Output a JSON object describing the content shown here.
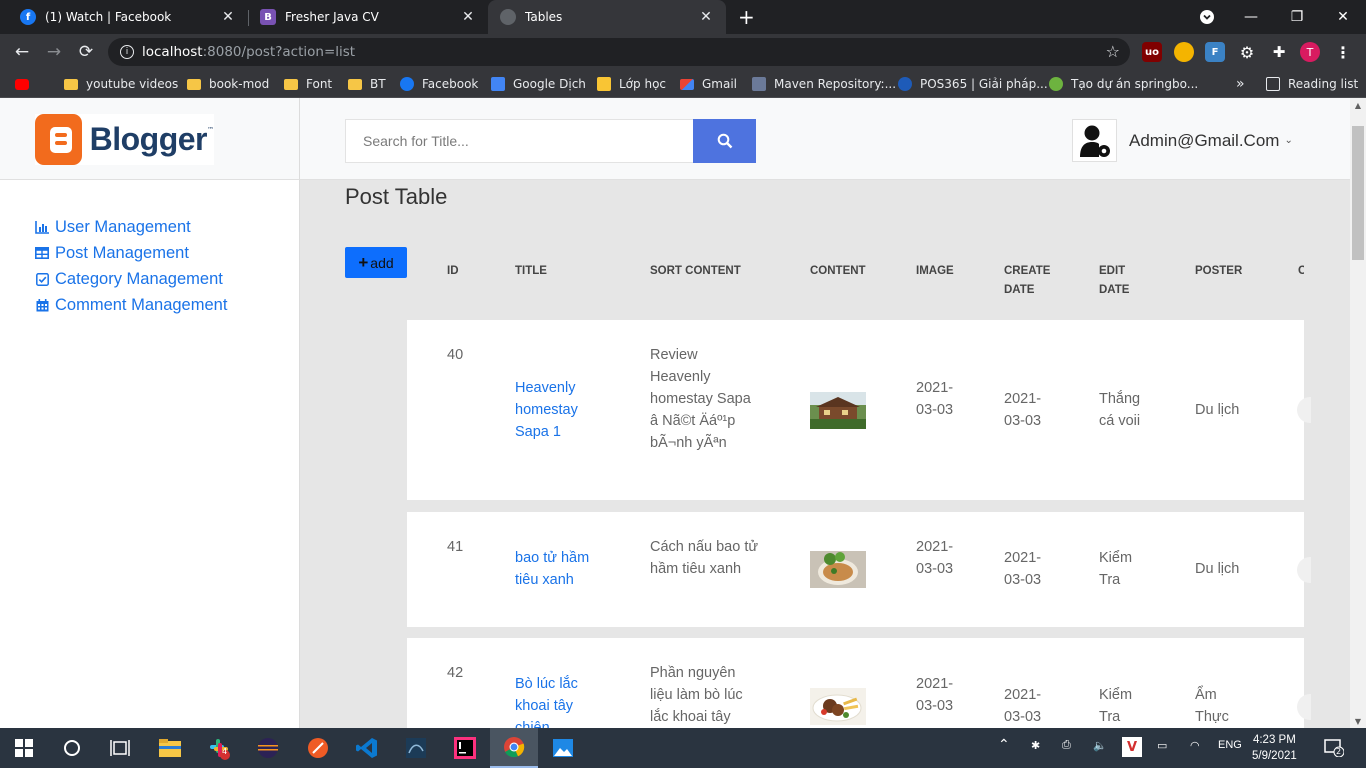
{
  "browser": {
    "tabs": [
      {
        "title": "(1) Watch | Facebook",
        "icon": "facebook-icon"
      },
      {
        "title": "Fresher Java CV",
        "icon": "bootstrap-icon"
      },
      {
        "title": "Tables",
        "icon": "globe-icon"
      }
    ],
    "url_host": "localhost",
    "url_path": ":8080/post?action=list",
    "bookmarks": [
      {
        "label": "youtube videos",
        "icon": "folder-icon"
      },
      {
        "label": "book-mod",
        "icon": "folder-icon"
      },
      {
        "label": "Font",
        "icon": "folder-icon"
      },
      {
        "label": "BT",
        "icon": "folder-icon"
      },
      {
        "label": "Facebook",
        "icon": "facebook-icon"
      },
      {
        "label": "Google Dịch",
        "icon": "google-translate-icon"
      },
      {
        "label": "Lớp học",
        "icon": "classroom-icon"
      },
      {
        "label": "Gmail",
        "icon": "gmail-icon"
      },
      {
        "label": "Maven Repository:...",
        "icon": "maven-icon"
      },
      {
        "label": "POS365 | Giải pháp...",
        "icon": "pos365-icon"
      },
      {
        "label": "Tạo dự án springbo...",
        "icon": "spring-icon"
      }
    ],
    "more_bookmarks": "»",
    "reading_list": "Reading list",
    "profile_initial": "T"
  },
  "app": {
    "logo_text": "Blogger",
    "logo_tm": "™",
    "search_placeholder": "Search for Title...",
    "account_name": "Admin@Gmail.Com",
    "page_title": "Post Table",
    "add_label": "add",
    "sidebar": [
      {
        "label": "User Management",
        "icon": "bar-chart-icon"
      },
      {
        "label": "Post Management",
        "icon": "table-icon"
      },
      {
        "label": "Category Management",
        "icon": "check-square-icon"
      },
      {
        "label": "Comment Management",
        "icon": "calendar-icon"
      }
    ],
    "columns": [
      "ID",
      "TITLE",
      "SORT CONTENT",
      "CONTENT",
      "IMAGE",
      "CREATE DATE",
      "EDIT DATE",
      "POSTER",
      "C"
    ],
    "rows": [
      {
        "id": "40",
        "title": "Heavenly homestay Sapa 1",
        "sort_content": "Review Heavenly homestay Sapa â Nã©t Äáº¹p bÃ¬nh yÃªn",
        "content_image": "homestay-thumbnail",
        "create_date": "2021-03-03",
        "edit_date": "2021-03-03",
        "poster": "Thắng cá voii",
        "category": "Du lịch"
      },
      {
        "id": "41",
        "title": "bao tử hầm tiêu xanh",
        "sort_content": "Cách nấu bao tử hầm tiêu xanh",
        "content_image": "soup-thumbnail",
        "create_date": "2021-03-03",
        "edit_date": "2021-03-03",
        "poster": "Kiểm Tra",
        "category": "Du lịch"
      },
      {
        "id": "42",
        "title": "Bò lúc lắc khoai tây chiên",
        "sort_content": "Phần nguyên liệu làm bò lúc lắc khoai tây",
        "content_image": "beef-fries-thumbnail",
        "create_date": "2021-03-03",
        "edit_date": "2021-03-03",
        "poster": "Kiểm Tra",
        "category": "Ẩm Thực"
      }
    ]
  },
  "taskbar": {
    "language": "ENG",
    "time": "4:23 PM",
    "date": "5/9/2021",
    "notifications": "2",
    "slack_badge": "4"
  }
}
